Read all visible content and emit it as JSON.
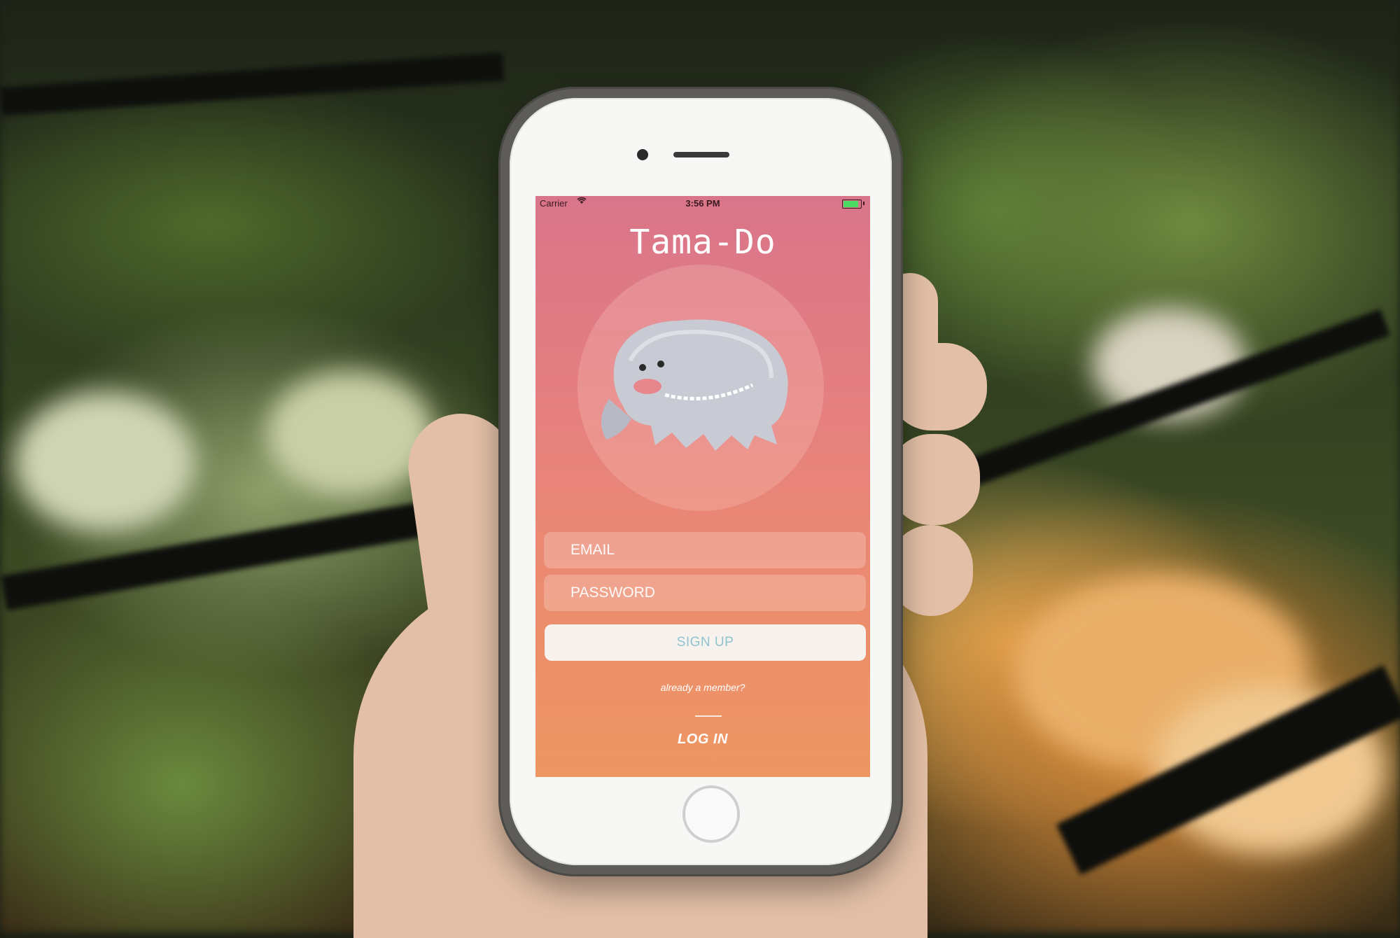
{
  "status_bar": {
    "carrier": "Carrier",
    "time": "3:56 PM",
    "wifi_icon": "wifi-icon",
    "battery_icon": "battery-icon",
    "battery_color": "#4cd964"
  },
  "app": {
    "title": "Tama-Do",
    "mascot_icon": "fluffy-monster-illustration",
    "gradient_colors": [
      "#d9758a",
      "#ee9762"
    ]
  },
  "form": {
    "email_placeholder": "EMAIL",
    "password_placeholder": "PASSWORD",
    "signup_label": "SIGN UP",
    "signup_text_color": "#8fc3cf"
  },
  "footer": {
    "member_prompt": "already a member?",
    "login_label": "LOG IN"
  }
}
